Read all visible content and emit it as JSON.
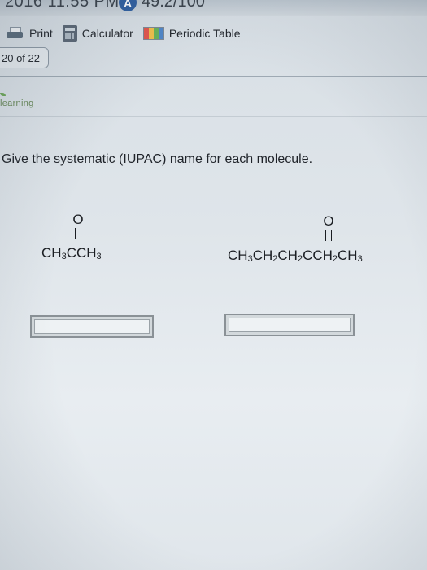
{
  "status_bar": {
    "time_text": "2016 11:55 PM",
    "score_badge": "A",
    "score_text": "49.2/100"
  },
  "toolbar": {
    "print_label": "Print",
    "calculator_label": "Calculator",
    "periodic_table_label": "Periodic Table"
  },
  "page_counter": "20 of 22",
  "logo_text": "learning",
  "question": {
    "prompt": "Give the systematic (IUPAC) name for each molecule.",
    "molecules": [
      {
        "carbonyl_oxygen": "O",
        "formula_parts": [
          "CH",
          "3",
          "CCH",
          "3"
        ]
      },
      {
        "carbonyl_oxygen": "O",
        "formula_parts": [
          "CH",
          "3",
          "CH",
          "2",
          "CH",
          "2",
          "CCH",
          "2",
          "CH",
          "3"
        ]
      }
    ],
    "answers": [
      {
        "value": "",
        "placeholder": ""
      },
      {
        "value": "",
        "placeholder": ""
      }
    ]
  }
}
